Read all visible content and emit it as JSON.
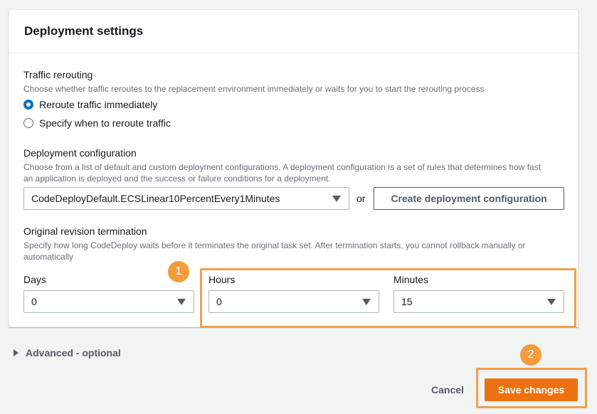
{
  "panel": {
    "title": "Deployment settings"
  },
  "traffic_rerouting": {
    "label": "Traffic rerouting",
    "description": "Choose whether traffic reroutes to the replacement environment immediately or waits for you to start the rerouting process",
    "options": [
      {
        "label": "Reroute traffic immediately",
        "checked": true
      },
      {
        "label": "Specify when to reroute traffic",
        "checked": false
      }
    ]
  },
  "deployment_configuration": {
    "label": "Deployment configuration",
    "description_line1": "Choose from a list of default and custom deployment configurations. A deployment configuration is a set of rules that determines how fast",
    "description_line2": "an application is deployed and the success or failure conditions for a deployment.",
    "selected": "CodeDeployDefault.ECSLinear10PercentEvery1Minutes",
    "or_text": "or",
    "create_button": "Create deployment configuration"
  },
  "original_revision_termination": {
    "label": "Original revision termination",
    "description_line1": "Specify how long CodeDeploy waits before it terminates the original task set. After termination starts, you cannot rollback manually or",
    "description_line2": "automatically",
    "days": {
      "label": "Days",
      "value": "0"
    },
    "hours": {
      "label": "Hours",
      "value": "0"
    },
    "minutes": {
      "label": "Minutes",
      "value": "15"
    }
  },
  "annotations": {
    "badge1": "1",
    "badge2": "2",
    "color": "#f0a04b"
  },
  "advanced": {
    "label": "Advanced - optional"
  },
  "footer": {
    "cancel": "Cancel",
    "save": "Save changes"
  },
  "colors": {
    "primary": "#ec7211",
    "radio_selected": "#0073bb",
    "text": "#16191f",
    "muted": "#687078"
  }
}
